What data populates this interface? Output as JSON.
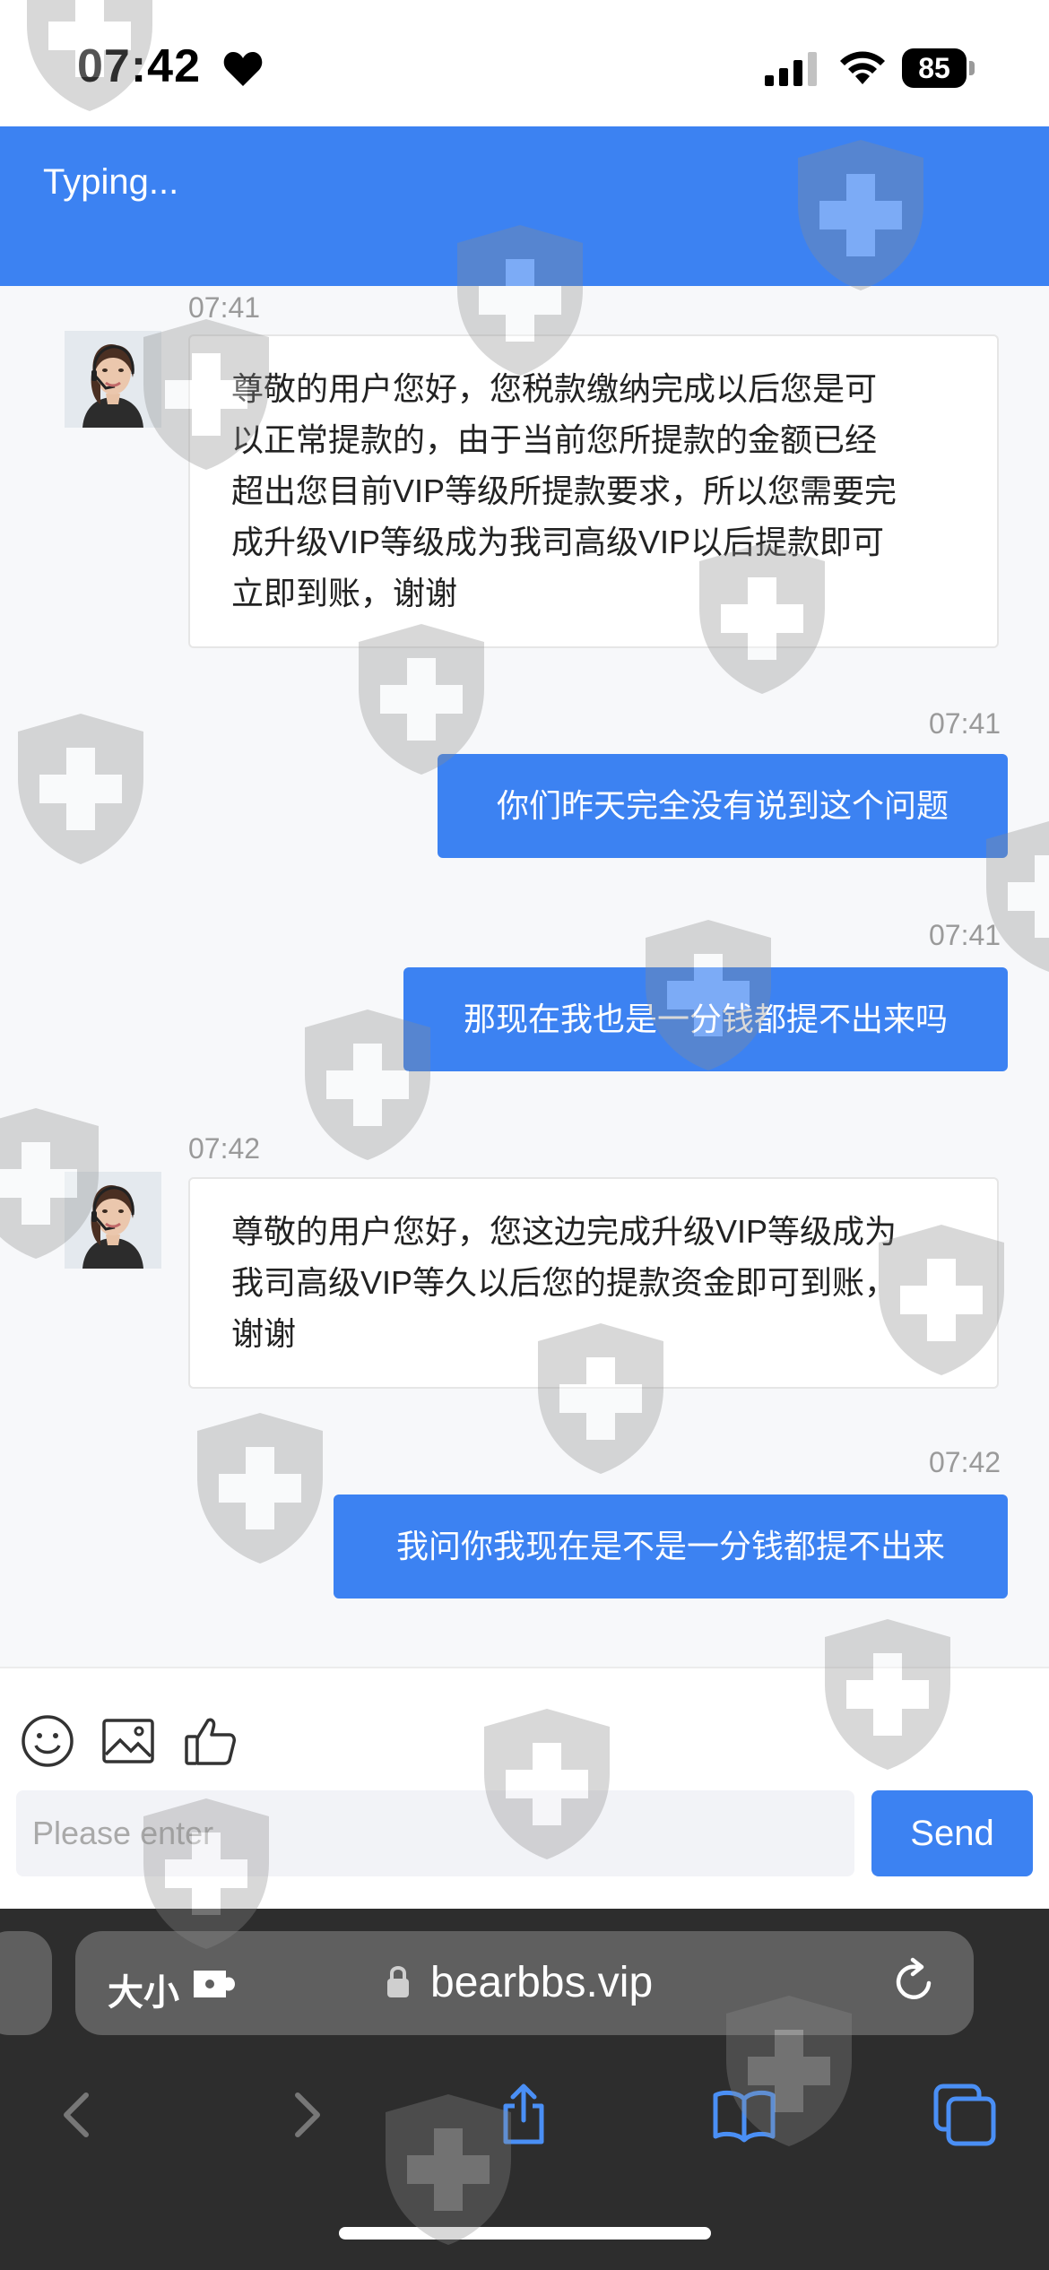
{
  "status_bar": {
    "time": "07:42",
    "battery": "85",
    "icons": [
      "heart-icon",
      "cellular-signal-icon",
      "wifi-icon",
      "battery-icon"
    ]
  },
  "header": {
    "title": "Typing..."
  },
  "messages": [
    {
      "direction": "incoming",
      "time": "07:41",
      "avatar": "agent-avatar",
      "text": "尊敬的用户您好，您税款缴纳完成以后您是可\n以正常提款的，由于当前您所提款的金额已经\n超出您目前VIP等级所提款要求，所以您需要完\n成升级VIP等级成为我司高级VIP以后提款即可\n立即到账，谢谢"
    },
    {
      "direction": "outgoing",
      "time": "07:41",
      "text": "你们昨天完全没有说到这个问题"
    },
    {
      "direction": "outgoing",
      "time": "07:41",
      "text": "那现在我也是一分钱都提不出来吗"
    },
    {
      "direction": "incoming",
      "time": "07:42",
      "avatar": "agent-avatar",
      "text": "尊敬的用户您好，您这边完成升级VIP等级成为\n我司高级VIP等久以后您的提款资金即可到账，\n谢谢"
    },
    {
      "direction": "outgoing",
      "time": "07:42",
      "text": "我问你我现在是不是一分钱都提不出来"
    }
  ],
  "toolbar": {
    "icons": [
      "emoji-icon",
      "image-icon",
      "thumbs-up-icon"
    ]
  },
  "composer": {
    "placeholder": "Please enter",
    "value": "",
    "send_label": "Send"
  },
  "browser": {
    "reader_label": "大小",
    "url": "bearbbs.vip",
    "nav_icons": [
      "back-icon",
      "forward-icon",
      "share-icon",
      "bookmarks-icon",
      "tabs-icon"
    ]
  },
  "colors": {
    "accent": "#3c82f2",
    "chat_background": "#f7f8fa",
    "browser_chrome": "#2d2d2d",
    "url_bar": "#5f5f5f"
  }
}
